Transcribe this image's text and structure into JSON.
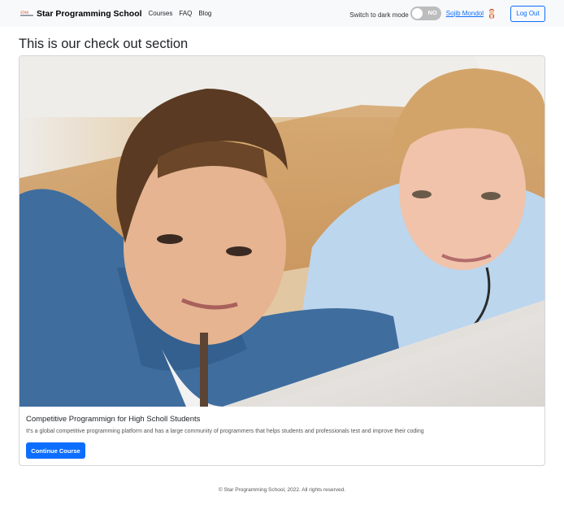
{
  "navbar": {
    "brand_logo_text": "STAR",
    "brand": "Star Programming School",
    "links": [
      "Courses",
      "FAQ",
      "Blog"
    ],
    "dark_mode_label": "Switch to dark mode",
    "toggle_state": "NO",
    "user_name": "Sojib Mondol",
    "logout_label": "Log Out"
  },
  "main": {
    "title": "This is our check out section",
    "card": {
      "title": "Competitive Programmign for High Scholl Students",
      "description": "It's a global competitive programming platform and has a large community of programmers that helps students and professionals test and improve their coding",
      "button_label": "Continue Course"
    }
  },
  "footer": {
    "text": "© Star Programming School, 2022. All rights reserved."
  },
  "colors": {
    "primary": "#0d6efd",
    "navbar_bg": "#f8f9fa",
    "toggle_bg": "#bdbdbd"
  }
}
